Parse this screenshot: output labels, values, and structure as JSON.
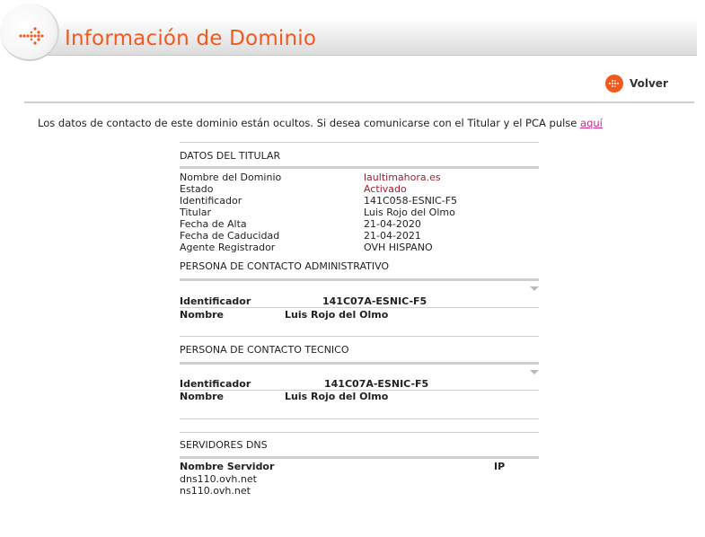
{
  "header": {
    "title": "Información de Dominio"
  },
  "nav": {
    "back_label": "Volver"
  },
  "notice": {
    "text": "Los datos de contacto de este dominio están ocultos. Si desea comunicarse con el Titular y el PCA pulse ",
    "link_label": "aquí"
  },
  "titular": {
    "section_title": "DATOS DEL TITULAR",
    "rows": [
      {
        "label": "Nombre del Dominio",
        "value": "laultimahora.es"
      },
      {
        "label": "Estado",
        "value": "Activado"
      },
      {
        "label": "Identificador",
        "value": "141C058-ESNIC-F5"
      },
      {
        "label": "Titular",
        "value": "Luis Rojo del Olmo"
      },
      {
        "label": "Fecha de Alta",
        "value": "21-04-2020"
      },
      {
        "label": "Fecha de Caducidad",
        "value": "21-04-2021"
      },
      {
        "label": "Agente Registrador",
        "value": "OVH HISPANO"
      }
    ]
  },
  "admin_contact": {
    "section_title": "PERSONA DE CONTACTO ADMINISTRATIVO",
    "id_label": "Identificador",
    "id_value": "141C07A-ESNIC-F5",
    "name_label": "Nombre",
    "name_value": "Luis Rojo del Olmo"
  },
  "tech_contact": {
    "section_title": "PERSONA DE CONTACTO TECNICO",
    "id_label": "Identificador",
    "id_value": "141C07A-ESNIC-F5",
    "name_label": "Nombre",
    "name_value": "Luis Rojo del Olmo"
  },
  "dns": {
    "section_title": "SERVIDORES DNS",
    "col_name": "Nombre Servidor",
    "col_ip": "IP",
    "servers": [
      "dns110.ovh.net",
      "ns110.ovh.net"
    ]
  },
  "colors": {
    "accent": "#f05a1e",
    "value_red": "#a01e2e",
    "link": "#cc2a8c"
  }
}
